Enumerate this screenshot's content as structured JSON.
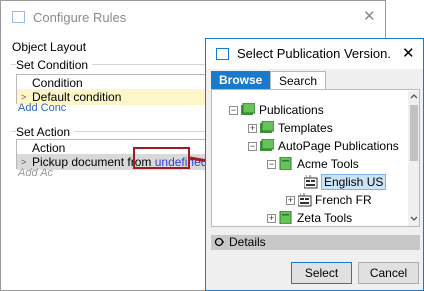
{
  "background_dialog": {
    "title": "Configure Rules",
    "close_glyph": "✕",
    "object_layout_label": "Object Layout",
    "set_condition": {
      "label": "Set Condition",
      "header": "Condition",
      "row": "Default condition",
      "add_link": "Add Conc"
    },
    "set_action": {
      "label": "Set Action",
      "header": "Action",
      "row_prefix": "Pickup document from",
      "row_value": "undefined",
      "add_link": "Add Ac"
    }
  },
  "dialog": {
    "title": "Select Publication Version.",
    "close_glyph": "✕",
    "tabs": [
      {
        "label": "Browse",
        "active": true
      },
      {
        "label": "Search",
        "active": false
      }
    ],
    "tree": [
      {
        "label": "Publications",
        "expander": "−",
        "icon": "publications-folder-icon"
      },
      {
        "label": "Templates",
        "expander": "+",
        "icon": "folder-icon"
      },
      {
        "label": "AutoPage Publications",
        "expander": "−",
        "icon": "folder-icon"
      },
      {
        "label": "Acme Tools",
        "expander": "−",
        "icon": "publication-icon"
      },
      {
        "label": "English US",
        "expander": "",
        "icon": "version-icon",
        "selected": true
      },
      {
        "label": "French FR",
        "expander": "+",
        "icon": "version-icon"
      },
      {
        "label": "Zeta Tools",
        "expander": "+",
        "icon": "publication-icon"
      }
    ],
    "details_label": "Details",
    "select_label": "Select",
    "cancel_label": "Cancel"
  },
  "colors": {
    "accent": "#1979ca",
    "highlight_row": "#fdf6c8",
    "annotation": "#a01c22",
    "selected_item": "#cce4f7"
  }
}
